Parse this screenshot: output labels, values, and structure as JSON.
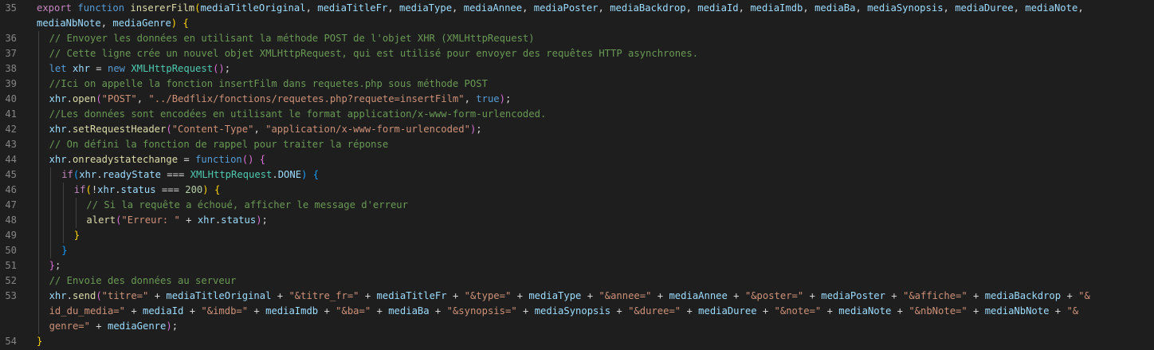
{
  "editor": {
    "lines": [
      {
        "number": "35",
        "indent": 0,
        "tokens": [
          {
            "t": "export",
            "c": "ctl"
          },
          {
            "t": " ",
            "c": "pl"
          },
          {
            "t": "function",
            "c": "kw"
          },
          {
            "t": " ",
            "c": "pl"
          },
          {
            "t": "insererFilm",
            "c": "fn"
          },
          {
            "t": "(",
            "c": "b1"
          },
          {
            "t": "mediaTitleOriginal",
            "c": "var"
          },
          {
            "t": ", ",
            "c": "pl"
          },
          {
            "t": "mediaTitleFr",
            "c": "var"
          },
          {
            "t": ", ",
            "c": "pl"
          },
          {
            "t": "mediaType",
            "c": "var"
          },
          {
            "t": ", ",
            "c": "pl"
          },
          {
            "t": "mediaAnnee",
            "c": "var"
          },
          {
            "t": ", ",
            "c": "pl"
          },
          {
            "t": "mediaPoster",
            "c": "var"
          },
          {
            "t": ", ",
            "c": "pl"
          },
          {
            "t": "mediaBackdrop",
            "c": "var"
          },
          {
            "t": ", ",
            "c": "pl"
          },
          {
            "t": "mediaId",
            "c": "var"
          },
          {
            "t": ", ",
            "c": "pl"
          },
          {
            "t": "mediaImdb",
            "c": "var"
          },
          {
            "t": ", ",
            "c": "pl"
          },
          {
            "t": "mediaBa",
            "c": "var"
          },
          {
            "t": ", ",
            "c": "pl"
          },
          {
            "t": "mediaSynopsis",
            "c": "var"
          },
          {
            "t": ", ",
            "c": "pl"
          },
          {
            "t": "mediaDuree",
            "c": "var"
          },
          {
            "t": ", ",
            "c": "pl"
          },
          {
            "t": "mediaNote",
            "c": "var"
          },
          {
            "t": ",",
            "c": "pl"
          }
        ]
      },
      {
        "number": "",
        "indent": 0,
        "tokens": [
          {
            "t": "mediaNbNote",
            "c": "var"
          },
          {
            "t": ", ",
            "c": "pl"
          },
          {
            "t": "mediaGenre",
            "c": "var"
          },
          {
            "t": ")",
            "c": "b1"
          },
          {
            "t": " ",
            "c": "pl"
          },
          {
            "t": "{",
            "c": "b1"
          }
        ]
      },
      {
        "number": "36",
        "indent": 1,
        "tokens": [
          {
            "t": "// Envoyer les données en utilisant la méthode POST de l'objet XHR (XMLHttpRequest)",
            "c": "cm"
          }
        ]
      },
      {
        "number": "37",
        "indent": 1,
        "tokens": [
          {
            "t": "// Cette ligne crée un nouvel objet XMLHttpRequest, qui est utilisé pour envoyer des requêtes HTTP asynchrones.",
            "c": "cm"
          }
        ]
      },
      {
        "number": "38",
        "indent": 1,
        "tokens": [
          {
            "t": "let",
            "c": "kw"
          },
          {
            "t": " ",
            "c": "pl"
          },
          {
            "t": "xhr",
            "c": "var"
          },
          {
            "t": " = ",
            "c": "pl"
          },
          {
            "t": "new",
            "c": "kw"
          },
          {
            "t": " ",
            "c": "pl"
          },
          {
            "t": "XMLHttpRequest",
            "c": "cls"
          },
          {
            "t": "(",
            "c": "b2"
          },
          {
            "t": ")",
            "c": "b2"
          },
          {
            "t": ";",
            "c": "pl"
          }
        ]
      },
      {
        "number": "39",
        "indent": 1,
        "tokens": [
          {
            "t": "//Ici on appelle la fonction insertFilm dans requetes.php sous méthode POST",
            "c": "cm"
          }
        ]
      },
      {
        "number": "40",
        "indent": 1,
        "tokens": [
          {
            "t": "xhr",
            "c": "var"
          },
          {
            "t": ".",
            "c": "pl"
          },
          {
            "t": "open",
            "c": "fn"
          },
          {
            "t": "(",
            "c": "b2"
          },
          {
            "t": "\"POST\"",
            "c": "str"
          },
          {
            "t": ", ",
            "c": "pl"
          },
          {
            "t": "\"../Bedflix/fonctions/requetes.php?requete=insertFilm\"",
            "c": "str"
          },
          {
            "t": ", ",
            "c": "pl"
          },
          {
            "t": "true",
            "c": "kw"
          },
          {
            "t": ")",
            "c": "b2"
          },
          {
            "t": ";",
            "c": "pl"
          }
        ]
      },
      {
        "number": "41",
        "indent": 1,
        "tokens": [
          {
            "t": "//Les données sont encodées en utilisant le format application/x-www-form-urlencoded.",
            "c": "cm"
          }
        ]
      },
      {
        "number": "42",
        "indent": 1,
        "tokens": [
          {
            "t": "xhr",
            "c": "var"
          },
          {
            "t": ".",
            "c": "pl"
          },
          {
            "t": "setRequestHeader",
            "c": "fn"
          },
          {
            "t": "(",
            "c": "b2"
          },
          {
            "t": "\"Content-Type\"",
            "c": "str"
          },
          {
            "t": ", ",
            "c": "pl"
          },
          {
            "t": "\"application/x-www-form-urlencoded\"",
            "c": "str"
          },
          {
            "t": ")",
            "c": "b2"
          },
          {
            "t": ";",
            "c": "pl"
          }
        ]
      },
      {
        "number": "43",
        "indent": 1,
        "tokens": [
          {
            "t": "// On défini la fonction de rappel pour traiter la réponse",
            "c": "cm"
          }
        ]
      },
      {
        "number": "44",
        "indent": 1,
        "tokens": [
          {
            "t": "xhr",
            "c": "var"
          },
          {
            "t": ".",
            "c": "pl"
          },
          {
            "t": "onreadystatechange",
            "c": "fn"
          },
          {
            "t": " = ",
            "c": "pl"
          },
          {
            "t": "function",
            "c": "kw"
          },
          {
            "t": "(",
            "c": "b2"
          },
          {
            "t": ")",
            "c": "b2"
          },
          {
            "t": " ",
            "c": "pl"
          },
          {
            "t": "{",
            "c": "b2"
          }
        ]
      },
      {
        "number": "45",
        "indent": 2,
        "tokens": [
          {
            "t": "if",
            "c": "ctl"
          },
          {
            "t": "(",
            "c": "b3"
          },
          {
            "t": "xhr",
            "c": "var"
          },
          {
            "t": ".",
            "c": "pl"
          },
          {
            "t": "readyState",
            "c": "var"
          },
          {
            "t": " === ",
            "c": "pl"
          },
          {
            "t": "XMLHttpRequest",
            "c": "cls"
          },
          {
            "t": ".",
            "c": "pl"
          },
          {
            "t": "DONE",
            "c": "var"
          },
          {
            "t": ")",
            "c": "b3"
          },
          {
            "t": " ",
            "c": "pl"
          },
          {
            "t": "{",
            "c": "b3"
          }
        ]
      },
      {
        "number": "46",
        "indent": 3,
        "tokens": [
          {
            "t": "if",
            "c": "ctl"
          },
          {
            "t": "(",
            "c": "b1"
          },
          {
            "t": "!",
            "c": "pl"
          },
          {
            "t": "xhr",
            "c": "var"
          },
          {
            "t": ".",
            "c": "pl"
          },
          {
            "t": "status",
            "c": "var"
          },
          {
            "t": " === ",
            "c": "pl"
          },
          {
            "t": "200",
            "c": "num"
          },
          {
            "t": ")",
            "c": "b1"
          },
          {
            "t": " ",
            "c": "pl"
          },
          {
            "t": "{",
            "c": "b1"
          }
        ]
      },
      {
        "number": "47",
        "indent": 4,
        "tokens": [
          {
            "t": "// Si la requête a échoué, afficher le message d'erreur",
            "c": "cm"
          }
        ]
      },
      {
        "number": "48",
        "indent": 4,
        "tokens": [
          {
            "t": "alert",
            "c": "fn"
          },
          {
            "t": "(",
            "c": "b2"
          },
          {
            "t": "\"Erreur: \"",
            "c": "str"
          },
          {
            "t": " + ",
            "c": "pl"
          },
          {
            "t": "xhr",
            "c": "var"
          },
          {
            "t": ".",
            "c": "pl"
          },
          {
            "t": "status",
            "c": "var"
          },
          {
            "t": ")",
            "c": "b2"
          },
          {
            "t": ";",
            "c": "pl"
          }
        ]
      },
      {
        "number": "49",
        "indent": 3,
        "tokens": [
          {
            "t": "}",
            "c": "b1"
          }
        ]
      },
      {
        "number": "50",
        "indent": 2,
        "tokens": [
          {
            "t": "}",
            "c": "b3"
          }
        ]
      },
      {
        "number": "51",
        "indent": 1,
        "tokens": [
          {
            "t": "}",
            "c": "b2"
          },
          {
            "t": ";",
            "c": "pl"
          }
        ]
      },
      {
        "number": "52",
        "indent": 1,
        "tokens": [
          {
            "t": "// Envoie des données au serveur",
            "c": "cm"
          }
        ]
      },
      {
        "number": "53",
        "indent": 1,
        "tokens": [
          {
            "t": "xhr",
            "c": "var"
          },
          {
            "t": ".",
            "c": "pl"
          },
          {
            "t": "send",
            "c": "fn"
          },
          {
            "t": "(",
            "c": "b2"
          },
          {
            "t": "\"titre=\"",
            "c": "str"
          },
          {
            "t": " + ",
            "c": "pl"
          },
          {
            "t": "mediaTitleOriginal",
            "c": "var"
          },
          {
            "t": " + ",
            "c": "pl"
          },
          {
            "t": "\"&titre_fr=\"",
            "c": "str"
          },
          {
            "t": " + ",
            "c": "pl"
          },
          {
            "t": "mediaTitleFr",
            "c": "var"
          },
          {
            "t": " + ",
            "c": "pl"
          },
          {
            "t": "\"&type=\"",
            "c": "str"
          },
          {
            "t": " + ",
            "c": "pl"
          },
          {
            "t": "mediaType",
            "c": "var"
          },
          {
            "t": " + ",
            "c": "pl"
          },
          {
            "t": "\"&annee=\"",
            "c": "str"
          },
          {
            "t": " + ",
            "c": "pl"
          },
          {
            "t": "mediaAnnee",
            "c": "var"
          },
          {
            "t": " + ",
            "c": "pl"
          },
          {
            "t": "\"&poster=\"",
            "c": "str"
          },
          {
            "t": " + ",
            "c": "pl"
          },
          {
            "t": "mediaPoster",
            "c": "var"
          },
          {
            "t": " + ",
            "c": "pl"
          },
          {
            "t": "\"&affiche=\"",
            "c": "str"
          },
          {
            "t": " + ",
            "c": "pl"
          },
          {
            "t": "mediaBackdrop",
            "c": "var"
          },
          {
            "t": " + ",
            "c": "pl"
          },
          {
            "t": "\"&",
            "c": "str"
          }
        ]
      },
      {
        "number": "",
        "indent": 1,
        "tokens": [
          {
            "t": "id_du_media=\"",
            "c": "str"
          },
          {
            "t": " + ",
            "c": "pl"
          },
          {
            "t": "mediaId",
            "c": "var"
          },
          {
            "t": " + ",
            "c": "pl"
          },
          {
            "t": "\"&imdb=\"",
            "c": "str"
          },
          {
            "t": " + ",
            "c": "pl"
          },
          {
            "t": "mediaImdb",
            "c": "var"
          },
          {
            "t": " + ",
            "c": "pl"
          },
          {
            "t": "\"&ba=\"",
            "c": "str"
          },
          {
            "t": " + ",
            "c": "pl"
          },
          {
            "t": "mediaBa",
            "c": "var"
          },
          {
            "t": " + ",
            "c": "pl"
          },
          {
            "t": "\"&synopsis=\"",
            "c": "str"
          },
          {
            "t": " + ",
            "c": "pl"
          },
          {
            "t": "mediaSynopsis",
            "c": "var"
          },
          {
            "t": " + ",
            "c": "pl"
          },
          {
            "t": "\"&duree=\"",
            "c": "str"
          },
          {
            "t": " + ",
            "c": "pl"
          },
          {
            "t": "mediaDuree",
            "c": "var"
          },
          {
            "t": " + ",
            "c": "pl"
          },
          {
            "t": "\"&note=\"",
            "c": "str"
          },
          {
            "t": " + ",
            "c": "pl"
          },
          {
            "t": "mediaNote",
            "c": "var"
          },
          {
            "t": " + ",
            "c": "pl"
          },
          {
            "t": "\"&nbNote=\"",
            "c": "str"
          },
          {
            "t": " + ",
            "c": "pl"
          },
          {
            "t": "mediaNbNote",
            "c": "var"
          },
          {
            "t": " + ",
            "c": "pl"
          },
          {
            "t": "\"&",
            "c": "str"
          }
        ]
      },
      {
        "number": "",
        "indent": 1,
        "tokens": [
          {
            "t": "genre=\"",
            "c": "str"
          },
          {
            "t": " + ",
            "c": "pl"
          },
          {
            "t": "mediaGenre",
            "c": "var"
          },
          {
            "t": ")",
            "c": "b2"
          },
          {
            "t": ";",
            "c": "pl"
          }
        ]
      },
      {
        "number": "54",
        "indent": 0,
        "tokens": [
          {
            "t": "}",
            "c": "b1"
          }
        ]
      }
    ]
  }
}
